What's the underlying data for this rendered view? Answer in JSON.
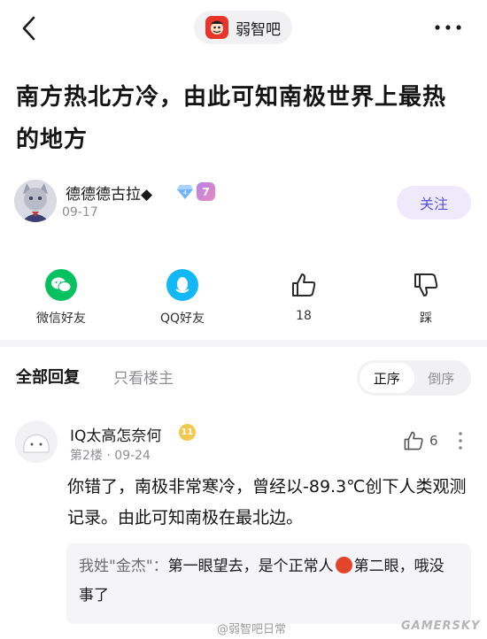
{
  "header": {
    "forum_name": "弱智吧"
  },
  "post": {
    "title": "南方热北方冷，由此可知南极世界上最热的地方",
    "author": {
      "name": "德德德古拉◆",
      "level": "7",
      "date": "09-17"
    },
    "follow_label": "关注"
  },
  "share": {
    "items": [
      {
        "label": "微信好友",
        "icon": "wechat-icon"
      },
      {
        "label": "QQ好友",
        "icon": "qq-icon"
      },
      {
        "label": "18",
        "icon": "thumbs-up-icon"
      },
      {
        "label": "踩",
        "icon": "thumbs-down-icon"
      }
    ]
  },
  "comments_header": {
    "tab_all": "全部回复",
    "tab_op": "只看楼主",
    "sort_asc": "正序",
    "sort_desc": "倒序"
  },
  "comment": {
    "name": "IQ太高怎奈何",
    "floor": "第2楼",
    "date": "09-24",
    "likes": "6",
    "text": "你错了，南极非常寒冷，曾经以-89.3℃创下人类观测记录。由此可知南极在最北边。",
    "sub_reply": {
      "name": "我姓\"金杰\"：",
      "text_before": "第一眼望去，是个正常人",
      "text_after": "第二眼，哦没事了"
    }
  },
  "watermarks": {
    "center": "@弱智吧日常",
    "right": "GAMERSKY"
  },
  "colors": {
    "accent": "#5a52d6",
    "follow_bg": "#eeeafb",
    "wechat": "#07c160",
    "qq": "#12b7f5"
  }
}
